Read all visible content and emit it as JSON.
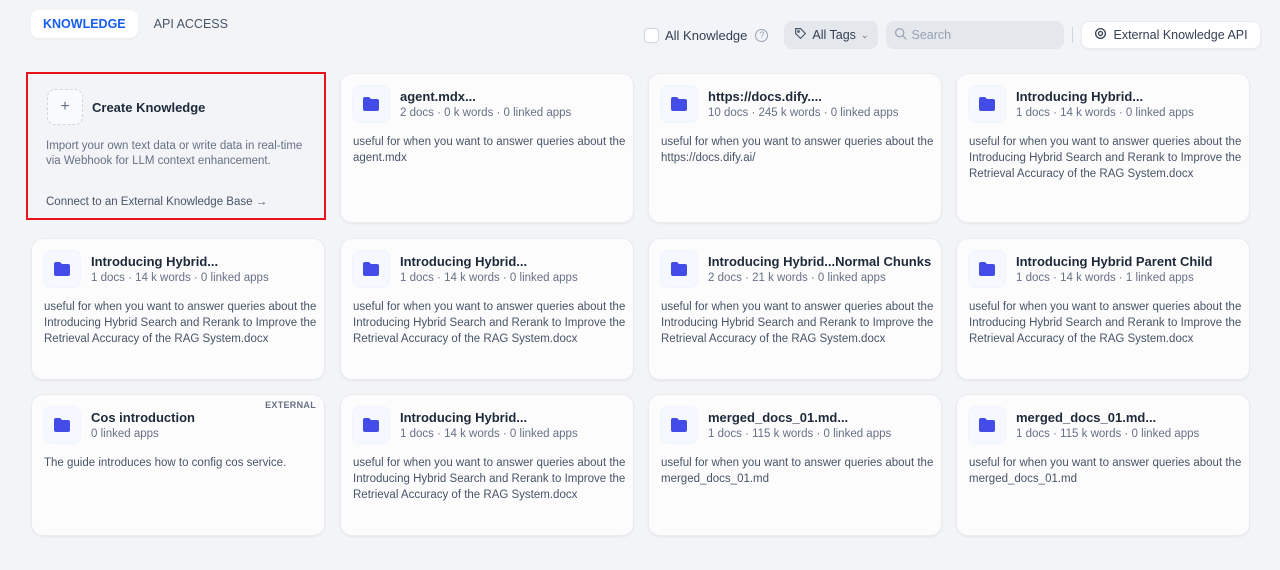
{
  "tabs": [
    {
      "label": "KNOWLEDGE",
      "active": true
    },
    {
      "label": "API ACCESS",
      "active": false
    }
  ],
  "toolbar": {
    "all_knowledge": "All Knowledge",
    "help": "?",
    "all_tags": "All Tags",
    "search_placeholder": "Search",
    "external_api": "External Knowledge API"
  },
  "create": {
    "title": "Create Knowledge",
    "plus": "+",
    "description": "Import your own text data or write data in real-time via Webhook for LLM context enhancement.",
    "link": "Connect to an External Knowledge Base →"
  },
  "accent": "#444ce7",
  "cards": [
    {
      "title": "agent.mdx...",
      "meta": "2 docs · 0 k words · 0 linked apps",
      "desc": "useful for when you want to answer queries about the agent.mdx"
    },
    {
      "title": "https://docs.dify....",
      "meta": "10 docs · 245 k words · 0 linked apps",
      "desc": "useful for when you want to answer queries about the https://docs.dify.ai/"
    },
    {
      "title": "Introducing Hybrid...",
      "meta": "1 docs · 14 k words · 0 linked apps",
      "desc": "useful for when you want to answer queries about the Introducing Hybrid Search and Rerank to Improve the Retrieval Accuracy of the RAG System.docx"
    },
    {
      "title": "Introducing Hybrid...",
      "meta": "1 docs · 14 k words · 0 linked apps",
      "desc": "useful for when you want to answer queries about the Introducing Hybrid Search and Rerank to Improve the Retrieval Accuracy of the RAG System.docx"
    },
    {
      "title": "Introducing Hybrid...",
      "meta": "1 docs · 14 k words · 0 linked apps",
      "desc": "useful for when you want to answer queries about the Introducing Hybrid Search and Rerank to Improve the Retrieval Accuracy of the RAG System.docx"
    },
    {
      "title": "Introducing Hybrid...Normal Chunks",
      "meta": "2 docs · 21 k words · 0 linked apps",
      "desc": "useful for when you want to answer queries about the Introducing Hybrid Search and Rerank to Improve the Retrieval Accuracy of the RAG System.docx"
    },
    {
      "title": "Introducing Hybrid Parent Child",
      "meta": "1 docs · 14 k words · 1 linked apps",
      "desc": "useful for when you want to answer queries about the Introducing Hybrid Search and Rerank to Improve the Retrieval Accuracy of the RAG System.docx"
    },
    {
      "title": "Cos introduction",
      "meta": "0 linked apps",
      "desc": "The guide introduces how to config cos service.",
      "badge": "EXTERNAL"
    },
    {
      "title": "Introducing Hybrid...",
      "meta": "1 docs · 14 k words · 0 linked apps",
      "desc": "useful for when you want to answer queries about the Introducing Hybrid Search and Rerank to Improve the Retrieval Accuracy of the RAG System.docx"
    },
    {
      "title": "merged_docs_01.md...",
      "meta": "1 docs · 115 k words · 0 linked apps",
      "desc": "useful for when you want to answer queries about the merged_docs_01.md"
    },
    {
      "title": "merged_docs_01.md...",
      "meta": "1 docs · 115 k words · 0 linked apps",
      "desc": "useful for when you want to answer queries about the merged_docs_01.md"
    }
  ]
}
